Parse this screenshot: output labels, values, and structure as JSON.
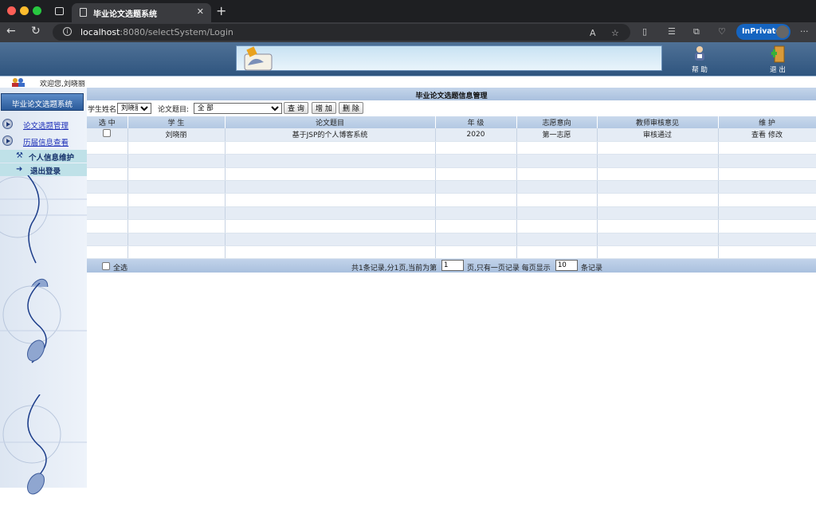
{
  "browser": {
    "tab_title": "毕业论文选题系统",
    "url_host": "localhost",
    "url_rest": ":8080/selectSystem/Login",
    "inprivate": "InPrivate"
  },
  "header": {
    "help": "帮 助",
    "logout": "退 出"
  },
  "welcome": "欢迎您,刘晓丽",
  "sidebar": {
    "title": "毕业论文选题系统",
    "items": [
      {
        "label": "论文选题管理"
      },
      {
        "label": "历届信息查看"
      }
    ],
    "items2": [
      {
        "label": "个人信息维护"
      },
      {
        "label": "退出登录"
      }
    ]
  },
  "main": {
    "title": "毕业论文选题信息管理",
    "filter": {
      "student_label": "学生姓名",
      "student_value": "刘晓丽",
      "topic_label": "论文题目:",
      "topic_value": "全 部",
      "query": "查 询",
      "add": "增 加",
      "delete": "删 除"
    },
    "columns": [
      "选 中",
      "学 生",
      "论文题目",
      "年 级",
      "志愿意向",
      "教师审核意见",
      "维 护"
    ],
    "rows": [
      {
        "student": "刘晓丽",
        "topic": "基于JSP的个人博客系统",
        "grade": "2020",
        "wish": "第一志愿",
        "review": "审核通过",
        "view": "查看",
        "edit": "修改"
      }
    ],
    "footer": {
      "select_all": "全选",
      "summary": "共1条记录,分1页,当前为第",
      "page": "1",
      "mid": "页,只有一页记录  每页显示",
      "per_page": "10",
      "tail": "条记录"
    }
  }
}
